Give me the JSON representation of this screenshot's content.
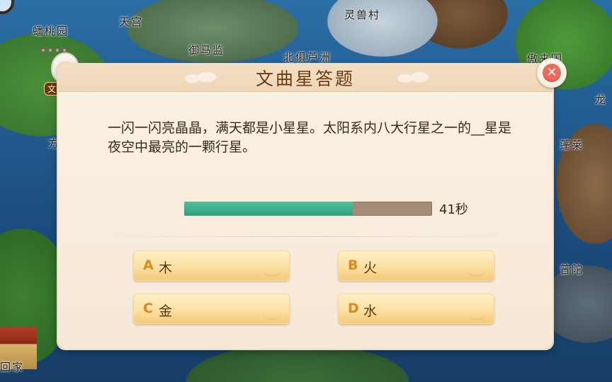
{
  "map": {
    "places": [
      {
        "id": "panta",
        "label": "蟠桃园"
      },
      {
        "id": "tiangong",
        "label": "天宫"
      },
      {
        "id": "lingshou",
        "label": "灵兽村"
      },
      {
        "id": "yuma",
        "label": "御马监"
      },
      {
        "id": "beiju",
        "label": "北俱芦洲"
      },
      {
        "id": "aolai",
        "label": "傲来国"
      },
      {
        "id": "long",
        "label": "龙"
      },
      {
        "id": "penglai",
        "label": "蓬莱"
      },
      {
        "id": "fang",
        "label": "方"
      },
      {
        "id": "putuo",
        "label": "普陀"
      },
      {
        "id": "home",
        "label": "回家"
      }
    ]
  },
  "npc": {
    "name": "文曲星"
  },
  "quiz": {
    "title": "文曲星答题",
    "question": "一闪一闪亮晶晶，满天都是小星星。太阳系内八大行星之一的__星是夜空中最亮的一颗行星。",
    "timer": {
      "remaining_label": "41秒",
      "fraction_remaining": 0.68
    },
    "options": [
      {
        "letter": "A",
        "text": "木"
      },
      {
        "letter": "B",
        "text": "火"
      },
      {
        "letter": "C",
        "text": "金"
      },
      {
        "letter": "D",
        "text": "水"
      }
    ],
    "close_icon": "close-icon"
  },
  "colors": {
    "timer_fill": "#3aa98a",
    "timer_track": "#a48b74",
    "title_text": "#6b3c12",
    "option_letter": "#d98b1c",
    "close_red": "#e0503f"
  }
}
